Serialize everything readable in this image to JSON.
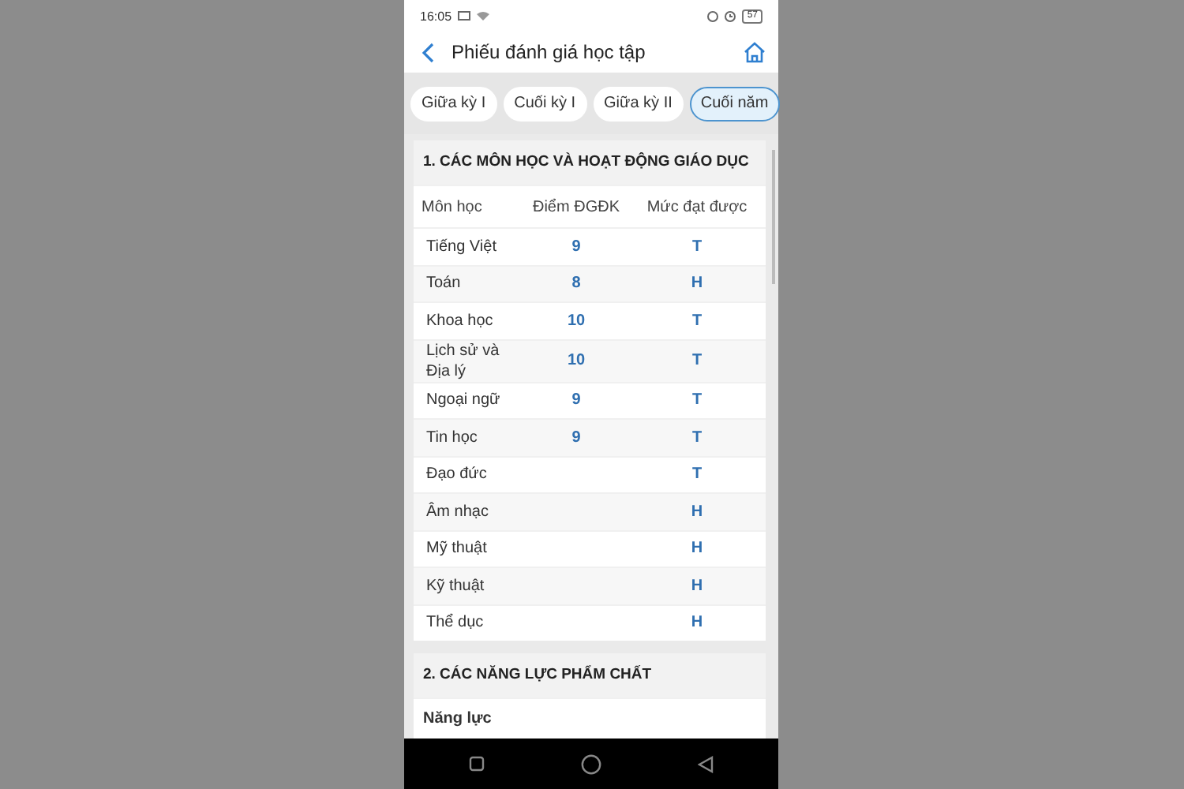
{
  "status_bar": {
    "time": "16:05",
    "battery": "57"
  },
  "header": {
    "title": "Phiếu đánh giá học tập"
  },
  "tabs": [
    {
      "label": "Giữa kỳ I",
      "selected": false
    },
    {
      "label": "Cuối kỳ I",
      "selected": false
    },
    {
      "label": "Giữa kỳ II",
      "selected": false
    },
    {
      "label": "Cuối năm",
      "selected": true
    }
  ],
  "section_1": {
    "title": "1. CÁC MÔN HỌC VÀ HOẠT ĐỘNG GIÁO DỤC",
    "columns": [
      "Môn học",
      "Điểm ĐGĐK",
      "Mức đạt được"
    ],
    "rows": [
      {
        "subject": "Tiếng Việt",
        "score": "9",
        "level": "T"
      },
      {
        "subject": "Toán",
        "score": "8",
        "level": "H"
      },
      {
        "subject": "Khoa học",
        "score": "10",
        "level": "T"
      },
      {
        "subject": "Lịch sử và Địa lý",
        "score": "10",
        "level": "T"
      },
      {
        "subject": "Ngoại ngữ",
        "score": "9",
        "level": "T"
      },
      {
        "subject": "Tin học",
        "score": "9",
        "level": "T"
      },
      {
        "subject": "Đạo đức",
        "level": "T"
      },
      {
        "subject": "Âm nhạc",
        "level": "H"
      },
      {
        "subject": "Mỹ thuật",
        "level": "H"
      },
      {
        "subject": "Kỹ thuật",
        "level": "H"
      },
      {
        "subject": "Thể dục",
        "level": "H"
      }
    ]
  },
  "section_2": {
    "title": "2. CÁC NĂNG LỰC PHẨM CHẤT",
    "subtitle": "Năng lực"
  }
}
